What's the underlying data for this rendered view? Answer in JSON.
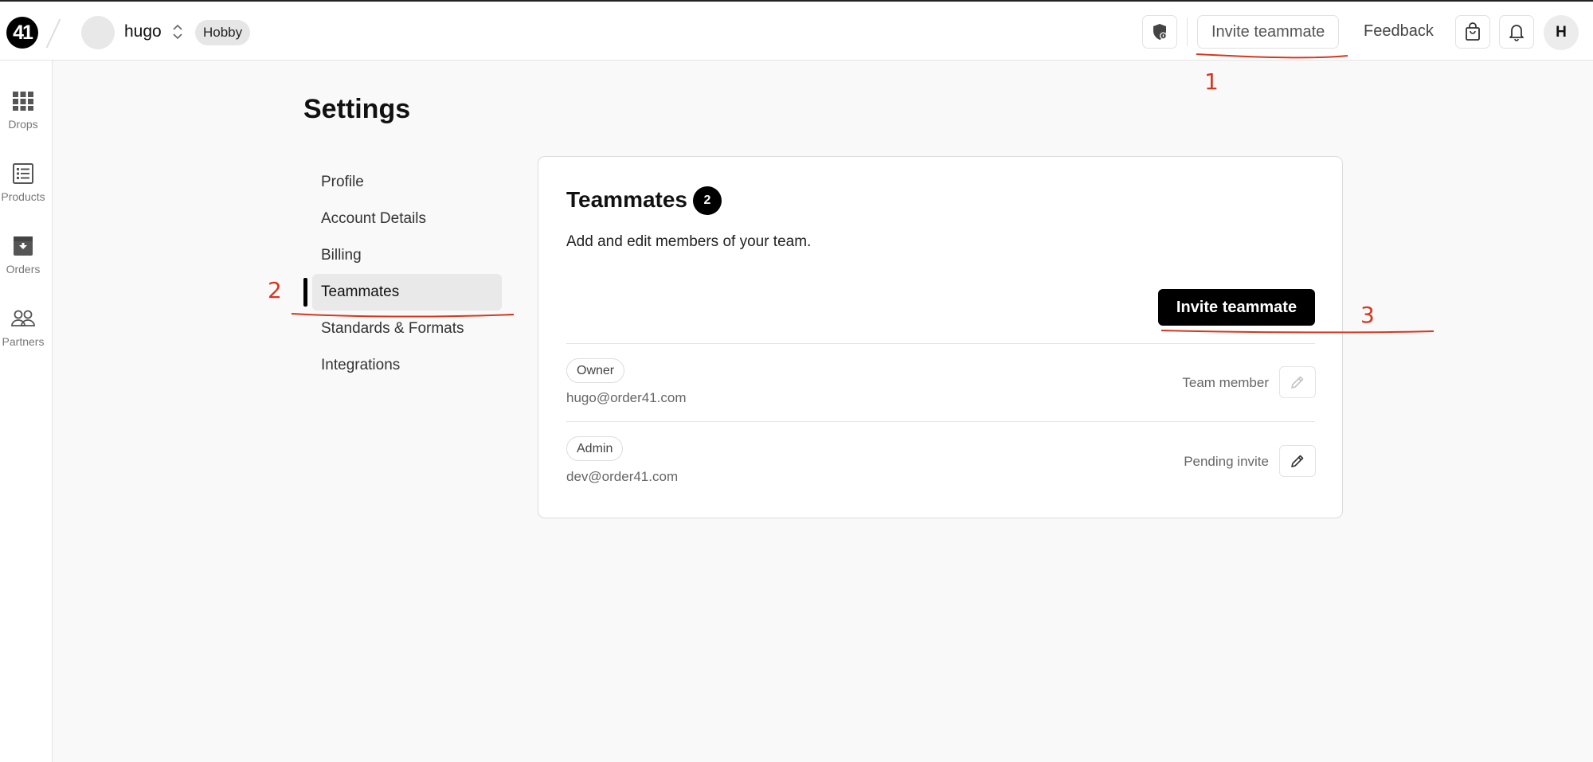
{
  "header": {
    "logo_text": "41",
    "workspace_name": "hugo",
    "plan_badge": "Hobby",
    "invite_label": "Invite teammate",
    "feedback_label": "Feedback",
    "user_initial": "H"
  },
  "sidebar": {
    "items": [
      {
        "label": "Drops",
        "icon": "grid-icon"
      },
      {
        "label": "Products",
        "icon": "list-icon"
      },
      {
        "label": "Orders",
        "icon": "inbox-icon"
      },
      {
        "label": "Partners",
        "icon": "people-icon"
      }
    ]
  },
  "settings": {
    "title": "Settings",
    "nav": [
      {
        "label": "Profile",
        "active": false
      },
      {
        "label": "Account Details",
        "active": false
      },
      {
        "label": "Billing",
        "active": false
      },
      {
        "label": "Teammates",
        "active": true
      },
      {
        "label": "Standards & Formats",
        "active": false
      },
      {
        "label": "Integrations",
        "active": false
      }
    ]
  },
  "teammates": {
    "title": "Teammates",
    "count": "2",
    "description": "Add and edit members of your team.",
    "invite_button": "Invite teammate",
    "members": [
      {
        "role": "Owner",
        "email": "hugo@order41.com",
        "status": "Team member",
        "edit_enabled": false
      },
      {
        "role": "Admin",
        "email": "dev@order41.com",
        "status": "Pending invite",
        "edit_enabled": true
      }
    ]
  },
  "annotations": {
    "one": "1",
    "two": "2",
    "three": "3",
    "color": "#d6371f"
  }
}
